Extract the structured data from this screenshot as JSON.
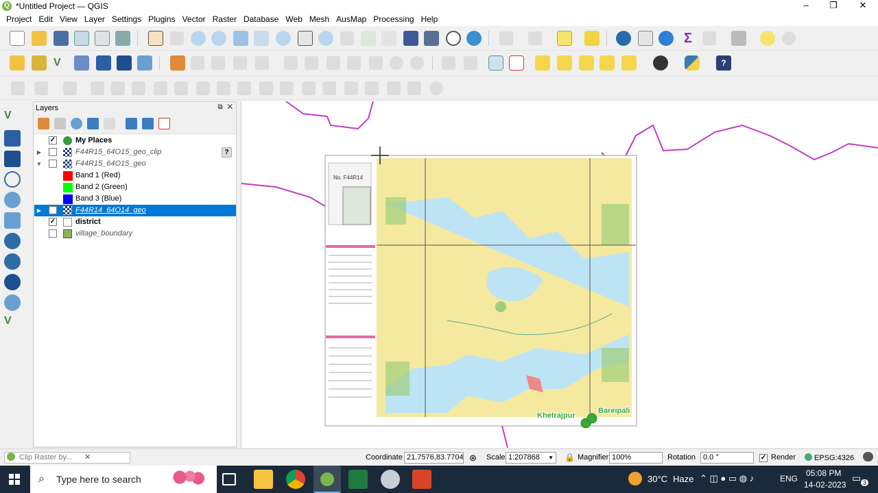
{
  "window": {
    "title": "*Untitled Project — QGIS",
    "minimize": "–",
    "maximize": "❐",
    "close": "✕"
  },
  "menu": [
    "Project",
    "Edit",
    "View",
    "Layer",
    "Settings",
    "Plugins",
    "Vector",
    "Raster",
    "Database",
    "Web",
    "Mesh",
    "AusMap",
    "Processing",
    "Help"
  ],
  "layers_panel": {
    "title": "Layers",
    "float_close": "⧉ ✕",
    "items": [
      {
        "name": "My Places",
        "checked": true,
        "bold": true,
        "italic": false,
        "symbol": "point-green"
      },
      {
        "name": "F44R15_64O15_geo_clip",
        "checked": false,
        "bold": false,
        "italic": true,
        "symbol": "raster",
        "warning": "?"
      },
      {
        "name": "F44R15_64O15_geo",
        "checked": false,
        "bold": false,
        "italic": true,
        "symbol": "raster"
      },
      {
        "name": "Band 1 (Red)",
        "band": true,
        "color": "#ff0000"
      },
      {
        "name": "Band 2 (Green)",
        "band": true,
        "color": "#00ff00"
      },
      {
        "name": "Band 3 (Blue)",
        "band": true,
        "color": "#0000ff"
      },
      {
        "name": "F44R14_64O14_geo",
        "checked": true,
        "bold": false,
        "italic": true,
        "symbol": "raster",
        "selected": true
      },
      {
        "name": "district",
        "checked": true,
        "bold": true,
        "italic": false,
        "symbol": "polygon-white"
      },
      {
        "name": "village_boundary",
        "checked": false,
        "bold": false,
        "italic": true,
        "symbol": "polygon-green"
      }
    ]
  },
  "map": {
    "sheet_no": "No. F44R14",
    "places": [
      {
        "name": "Khetrajpur"
      },
      {
        "name": "Bareipali"
      }
    ],
    "colors": {
      "boundary": "#c33bc3",
      "water": "#bde4f4",
      "land": "#f5e9a0",
      "forest": "#9fcf7a",
      "place_label": "#3aa83a"
    }
  },
  "statusbar": {
    "locator_placeholder": "Clip Raster by...",
    "coordinate_label": "Coordinate",
    "coordinate_value": "21.7576,83.7704",
    "scale_label": "Scale",
    "scale_value": "1:207868",
    "magnifier_label": "Magnifier",
    "magnifier_value": "100%",
    "rotation_label": "Rotation",
    "rotation_value": "0.0 °",
    "render_label": "Render",
    "crs": "EPSG:4326"
  },
  "taskbar": {
    "search_placeholder": "Type here to search",
    "weather_temp": "30°C",
    "weather_desc": "Haze",
    "lang": "ENG",
    "time": "05:08 PM",
    "date": "14-02-2023",
    "notif_count": "3"
  }
}
